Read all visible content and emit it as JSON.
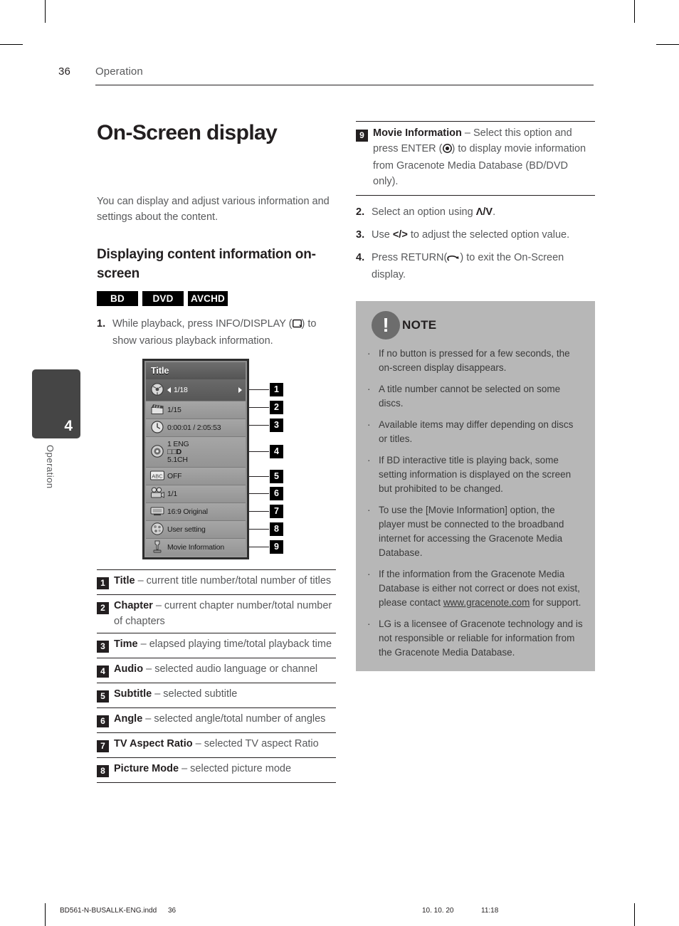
{
  "header": {
    "page_number": "36",
    "section": "Operation"
  },
  "sidebar": {
    "chapter_number": "4",
    "chapter_label": "Operation"
  },
  "left_column": {
    "title": "On-Screen display",
    "intro": "You can display and adjust various information and settings about the content.",
    "subhead": "Displaying content information on-screen",
    "badges": [
      "BD",
      "DVD",
      "AVCHD"
    ],
    "step1": {
      "num": "1.",
      "text_before": "While playback, press INFO/DISPLAY (",
      "icon": "info-display-icon",
      "text_after": ") to show various playback information."
    }
  },
  "osd": {
    "title": "Title",
    "rows": [
      {
        "icon": "title-disc-icon",
        "value": "1/18",
        "selected": true,
        "arrows": true
      },
      {
        "icon": "chapter-clap-icon",
        "value": "1/15",
        "selected": false,
        "arrows": false
      },
      {
        "icon": "time-clock-icon",
        "value": "0:00:01 / 2:05:53",
        "selected": false,
        "arrows": false
      },
      {
        "icon": "audio-disc-icon",
        "value": "1 ENG",
        "value2": "□□D",
        "value3": "5.1CH",
        "selected": false,
        "arrows": false
      },
      {
        "icon": "subtitle-abc-icon",
        "value": "OFF",
        "selected": false,
        "arrows": false
      },
      {
        "icon": "angle-camera-icon",
        "value": "1/1",
        "selected": false,
        "arrows": false
      },
      {
        "icon": "tv-aspect-icon",
        "value": "16:9 Original",
        "selected": false,
        "arrows": false
      },
      {
        "icon": "picture-mode-icon",
        "value": "User setting",
        "selected": false,
        "arrows": false
      },
      {
        "icon": "movie-info-icon",
        "value": "Movie Information",
        "selected": false,
        "arrows": false
      }
    ],
    "callouts": [
      "1",
      "2",
      "3",
      "4",
      "5",
      "6",
      "7",
      "8",
      "9"
    ]
  },
  "legend": [
    {
      "num": "1",
      "term": "Title",
      "desc": " – current title number/total number of titles"
    },
    {
      "num": "2",
      "term": "Chapter",
      "desc": " – current chapter number/total number of chapters"
    },
    {
      "num": "3",
      "term": "Time",
      "desc": " – elapsed playing time/total playback time"
    },
    {
      "num": "4",
      "term": "Audio",
      "desc": " – selected audio language or channel"
    },
    {
      "num": "5",
      "term": "Subtitle",
      "desc": " – selected subtitle"
    },
    {
      "num": "6",
      "term": "Angle",
      "desc": " – selected angle/total number of angles"
    },
    {
      "num": "7",
      "term": "TV Aspect Ratio",
      "desc": " – selected TV aspect Ratio"
    },
    {
      "num": "8",
      "term": "Picture Mode",
      "desc": " – selected picture mode"
    }
  ],
  "right_column": {
    "legend9": {
      "num": "9",
      "term": "Movie Information",
      "desc_before": " – Select this option and press ENTER (",
      "icon": "enter-button-icon",
      "desc_after": ") to display movie information from Gracenote Media Database (BD/DVD only)."
    },
    "step2": {
      "num": "2.",
      "text_before": "Select an option using ",
      "keys": "Λ/V",
      "text_after": "."
    },
    "step3": {
      "num": "3.",
      "text_before": "Use ",
      "keys": "</>",
      "text_after": " to adjust the selected option value."
    },
    "step4": {
      "num": "4.",
      "text_before": "Press RETURN(",
      "icon": "return-arrow-icon",
      "text_after": ") to exit the On-Screen display."
    }
  },
  "note": {
    "title": "NOTE",
    "icon": "exclamation-icon",
    "items": [
      {
        "text": "If no button is pressed for a few seconds, the on-screen display disappears."
      },
      {
        "text": "A title number cannot be selected on some discs."
      },
      {
        "text": "Available items may differ depending on discs or titles."
      },
      {
        "text": "If BD interactive title is playing back, some setting information is displayed on the screen but prohibited to be changed."
      },
      {
        "text": "To use the [Movie Information] option, the player must be connected to the broadband internet for accessing the Gracenote Media Database."
      },
      {
        "text_before": "If the information from the Gracenote Media Database is either not correct or does not exist, please contact ",
        "link": "www.gracenote.com",
        "text_after": " for support."
      },
      {
        "text": "LG is a licensee of Gracenote technology and is not responsible or reliable for information from the Gracenote Media Database."
      }
    ]
  },
  "footer": {
    "file_name": "BD561-N-BUSALLK-ENG.indd",
    "page": "36",
    "date": "10. 10. 20",
    "time": "11:18"
  }
}
